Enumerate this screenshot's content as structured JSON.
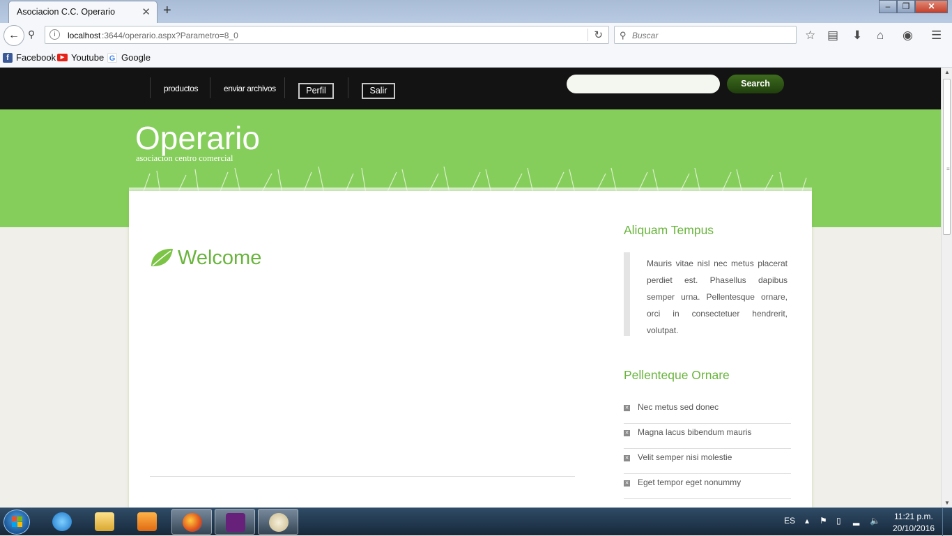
{
  "browser": {
    "tab_title": "Asociacion C.C. Operario",
    "tab_close": "✕",
    "new_tab": "+",
    "url_host": "localhost",
    "url_rest": ":3644/operario.aspx?Parametro=8_0",
    "search_placeholder": "Buscar",
    "bookmarks": [
      "Facebook",
      "Youtube",
      "Google"
    ],
    "icons": [
      "back-arrow-icon",
      "key-icon",
      "info-icon",
      "reload-icon",
      "search-icon",
      "star-icon",
      "reading-list-icon",
      "download-icon",
      "home-icon",
      "pocket-icon",
      "hamburger-menu-icon"
    ]
  },
  "site": {
    "menu": {
      "links": [
        "productos",
        "enviar archivos"
      ],
      "buttons": [
        "Perfil",
        "Salir"
      ],
      "search_button": "Search"
    },
    "title": "Operario",
    "subtitle": "asociacion centro comercial",
    "welcome": "Welcome",
    "sidebar": {
      "section1_title": "Aliquam Tempus",
      "quote": "Mauris vitae nisl nec metus placerat perdiet est. Phasellus dapibus semper urna. Pellentesque ornare, orci in consectetuer hendrerit, volutpat.",
      "section2_title": "Pellenteque Ornare",
      "items": [
        "Nec metus sed donec",
        "Magna lacus bibendum mauris",
        "Velit semper nisi molestie",
        "Eget tempor eget nonummy"
      ]
    },
    "colors": {
      "accent_green": "#69b43c",
      "header_green": "#86ce5b",
      "menu_black": "#131313"
    }
  },
  "taskbar": {
    "language": "ES",
    "time": "11:21 p.m.",
    "date": "20/10/2016",
    "apps": [
      "internet-explorer",
      "file-explorer",
      "media-player",
      "firefox",
      "visual-studio",
      "paint"
    ]
  }
}
